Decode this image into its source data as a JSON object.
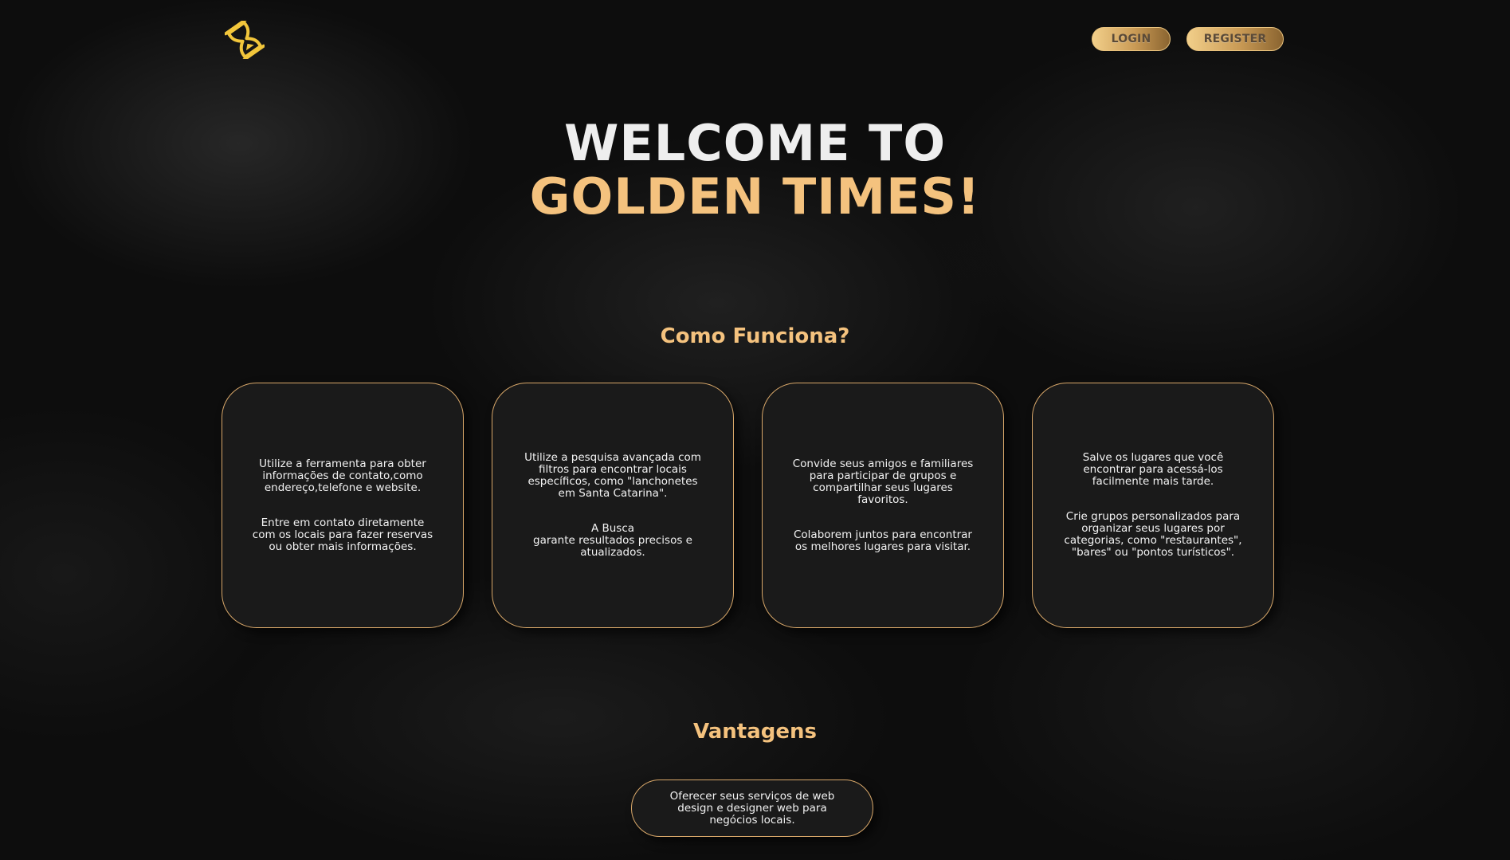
{
  "colors": {
    "accent_gold": "#f4c27e",
    "card_border": "#d9a86a",
    "card_bg": "#1a1a1a",
    "text_light": "#eeeeee"
  },
  "header": {
    "logo_icon": "hourglass-logo-icon",
    "login_label": "LOGIN",
    "register_label": "REGISTER"
  },
  "hero": {
    "line1": "WELCOME TO",
    "line2": "GOLDEN TIMES!"
  },
  "how_it_works": {
    "title": "Como Funciona?",
    "cards": [
      {
        "p1": "Utilize a ferramenta para obter informações de contato,como endereço,telefone e website.",
        "p2": "Entre em contato diretamente com os locais para fazer reservas ou obter mais informações."
      },
      {
        "p1": "Utilize a pesquisa avançada com filtros para encontrar locais específicos, como \"lanchonetes em Santa Catarina\".",
        "p2": "A Busca\ngarante resultados precisos e atualizados."
      },
      {
        "p1": "Convide seus amigos e familiares para participar de grupos e compartilhar seus lugares favoritos.",
        "p2": "Colaborem juntos para encontrar os melhores lugares para visitar."
      },
      {
        "p1": "Salve os lugares que você encontrar para acessá-los facilmente mais tarde.",
        "p2": "Crie grupos personalizados para organizar seus lugares por categorias, como \"restaurantes\", \"bares\" ou \"pontos turísticos\"."
      }
    ]
  },
  "advantages": {
    "title": "Vantagens",
    "items": [
      "Oferecer seus serviços de web design e designer web para negócios locais."
    ]
  }
}
